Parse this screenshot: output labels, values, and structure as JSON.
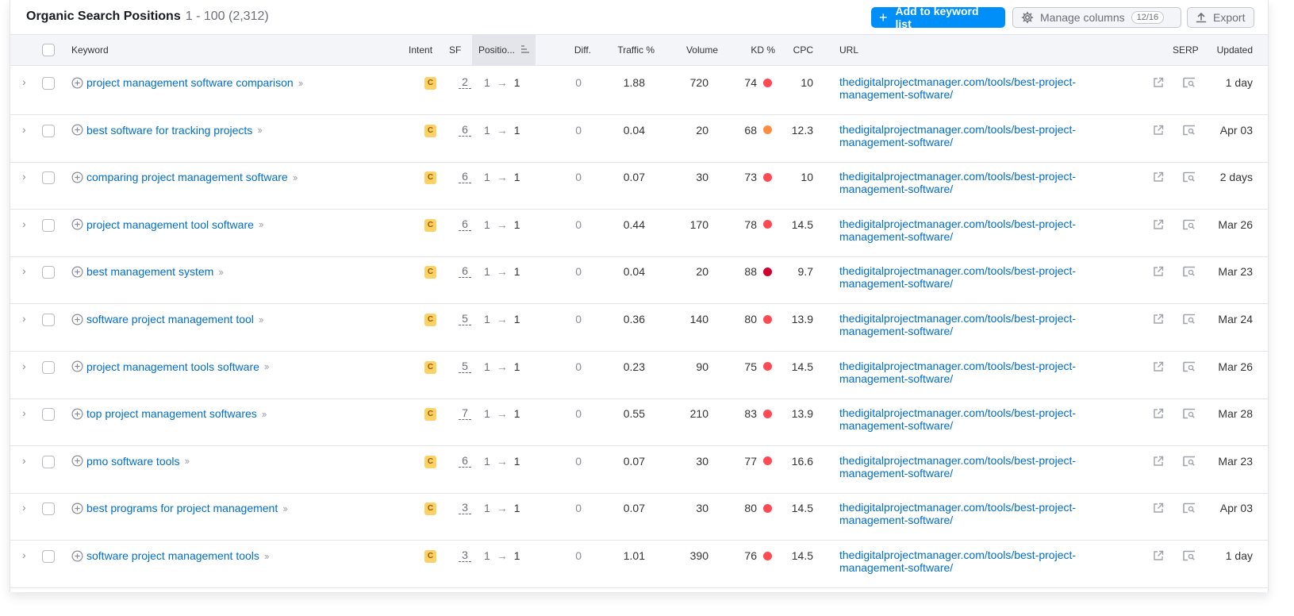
{
  "header": {
    "title": "Organic Search Positions",
    "range": "1 - 100 (2,312)",
    "add_button": "Add to keyword list",
    "manage_button": "Manage columns",
    "manage_counter": "12/16",
    "export_button": "Export",
    "accent_color": "#008ff8"
  },
  "columns": {
    "keyword": "Keyword",
    "intent": "Intent",
    "sf": "SF",
    "position": "Positio...",
    "diff": "Diff.",
    "traffic": "Traffic %",
    "volume": "Volume",
    "kd": "KD %",
    "cpc": "CPC",
    "url": "URL",
    "serp": "SERP",
    "updated": "Updated"
  },
  "rows": [
    {
      "keyword": "project management software comparison",
      "intent": "C",
      "sf": "2",
      "pos_from": "1",
      "pos_to": "1",
      "diff": "0",
      "traffic": "1.88",
      "volume": "720",
      "kd": "74",
      "kd_color": "#ff4953",
      "cpc": "10",
      "url": "thedigitalprojectmanager.com/tools/best-project-management-software/",
      "updated": "1 day"
    },
    {
      "keyword": "best software for tracking projects",
      "intent": "C",
      "sf": "6",
      "pos_from": "1",
      "pos_to": "1",
      "diff": "0",
      "traffic": "0.04",
      "volume": "20",
      "kd": "68",
      "kd_color": "#ff8c43",
      "cpc": "12.3",
      "url": "thedigitalprojectmanager.com/tools/best-project-management-software/",
      "updated": "Apr 03"
    },
    {
      "keyword": "comparing project management software",
      "intent": "C",
      "sf": "6",
      "pos_from": "1",
      "pos_to": "1",
      "diff": "0",
      "traffic": "0.07",
      "volume": "30",
      "kd": "73",
      "kd_color": "#ff4953",
      "cpc": "10",
      "url": "thedigitalprojectmanager.com/tools/best-project-management-software/",
      "updated": "2 days"
    },
    {
      "keyword": "project management tool software",
      "intent": "C",
      "sf": "6",
      "pos_from": "1",
      "pos_to": "1",
      "diff": "0",
      "traffic": "0.44",
      "volume": "170",
      "kd": "78",
      "kd_color": "#ff4953",
      "cpc": "14.5",
      "url": "thedigitalprojectmanager.com/tools/best-project-management-software/",
      "updated": "Mar 26"
    },
    {
      "keyword": "best management system",
      "intent": "C",
      "sf": "6",
      "pos_from": "1",
      "pos_to": "1",
      "diff": "0",
      "traffic": "0.04",
      "volume": "20",
      "kd": "88",
      "kd_color": "#d1002f",
      "cpc": "9.7",
      "url": "thedigitalprojectmanager.com/tools/best-project-management-software/",
      "updated": "Mar 23"
    },
    {
      "keyword": "software project management tool",
      "intent": "C",
      "sf": "5",
      "pos_from": "1",
      "pos_to": "1",
      "diff": "0",
      "traffic": "0.36",
      "volume": "140",
      "kd": "80",
      "kd_color": "#ff4953",
      "cpc": "13.9",
      "url": "thedigitalprojectmanager.com/tools/best-project-management-software/",
      "updated": "Mar 24"
    },
    {
      "keyword": "project management tools software",
      "intent": "C",
      "sf": "5",
      "pos_from": "1",
      "pos_to": "1",
      "diff": "0",
      "traffic": "0.23",
      "volume": "90",
      "kd": "75",
      "kd_color": "#ff4953",
      "cpc": "14.5",
      "url": "thedigitalprojectmanager.com/tools/best-project-management-software/",
      "updated": "Mar 26"
    },
    {
      "keyword": "top project management softwares",
      "intent": "C",
      "sf": "7",
      "pos_from": "1",
      "pos_to": "1",
      "diff": "0",
      "traffic": "0.55",
      "volume": "210",
      "kd": "83",
      "kd_color": "#ff4953",
      "cpc": "13.9",
      "url": "thedigitalprojectmanager.com/tools/best-project-management-software/",
      "updated": "Mar 28"
    },
    {
      "keyword": "pmo software tools",
      "intent": "C",
      "sf": "6",
      "pos_from": "1",
      "pos_to": "1",
      "diff": "0",
      "traffic": "0.07",
      "volume": "30",
      "kd": "77",
      "kd_color": "#ff4953",
      "cpc": "16.6",
      "url": "thedigitalprojectmanager.com/tools/best-project-management-software/",
      "updated": "Mar 23"
    },
    {
      "keyword": "best programs for project management",
      "intent": "C",
      "sf": "3",
      "pos_from": "1",
      "pos_to": "1",
      "diff": "0",
      "traffic": "0.07",
      "volume": "30",
      "kd": "80",
      "kd_color": "#ff4953",
      "cpc": "14.5",
      "url": "thedigitalprojectmanager.com/tools/best-project-management-software/",
      "updated": "Apr 03"
    },
    {
      "keyword": "software project management tools",
      "intent": "C",
      "sf": "3",
      "pos_from": "1",
      "pos_to": "1",
      "diff": "0",
      "traffic": "1.01",
      "volume": "390",
      "kd": "76",
      "kd_color": "#ff4953",
      "cpc": "14.5",
      "url": "thedigitalprojectmanager.com/tools/best-project-management-software/",
      "updated": "1 day"
    }
  ]
}
